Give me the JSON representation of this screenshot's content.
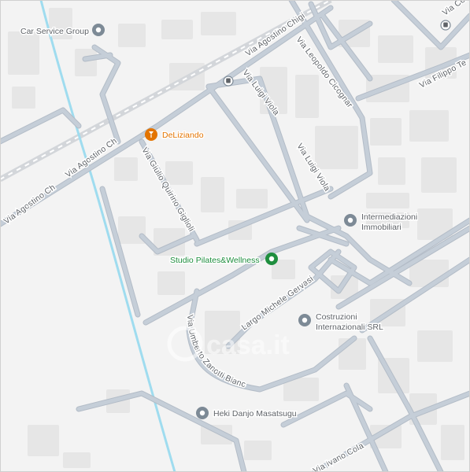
{
  "map": {
    "colors": {
      "land": "#f3f3f3",
      "building": "#e6e6e6",
      "road": "#c5ced8",
      "road_outline": "#b3bcc7",
      "railway": "#d3d6da",
      "waterway": "#9fdcef",
      "poi_generic": "#7d8a96",
      "poi_food": "#e37400",
      "poi_fitness": "#1e8e3e"
    },
    "roads": [
      {
        "name": "Via Agostino Chigi"
      },
      {
        "name": "Via Agostino Chigi"
      },
      {
        "name": "Via Agostino Chigi"
      },
      {
        "name": "Via Leopoldo Cicognara"
      },
      {
        "name": "Via Luigi Viola"
      },
      {
        "name": "Via Luigi Viola"
      },
      {
        "name": "Via Giulio Quirino Giglioli"
      },
      {
        "name": "Largo Michele Gervasio"
      },
      {
        "name": "Via Umberto Zanotti Bianco"
      },
      {
        "name": "Via Filippo Te"
      },
      {
        "name": "Via Ivano Colagrossi"
      },
      {
        "name": "Via Cornicali"
      }
    ],
    "places": [
      {
        "name": "Car Service Group",
        "icon": "place-pin-icon",
        "kind": "generic"
      },
      {
        "name": "DeLiziando",
        "icon": "food-pin-icon",
        "kind": "food"
      },
      {
        "name": "Intermediazioni Immobiliari",
        "icon": "place-pin-icon",
        "kind": "generic"
      },
      {
        "name": "Studio Pilates&Wellness",
        "icon": "fitness-pin-icon",
        "kind": "fitness"
      },
      {
        "name": "Costruzioni Internazionali SRL",
        "icon": "place-pin-icon",
        "kind": "generic"
      },
      {
        "name": "Heki Danjo Masatsugu",
        "icon": "place-pin-icon",
        "kind": "generic"
      }
    ],
    "transit": [
      {
        "icon": "bus-stop-icon"
      },
      {
        "icon": "bus-stop-icon"
      }
    ],
    "watermark": {
      "text": "casa.it"
    }
  }
}
